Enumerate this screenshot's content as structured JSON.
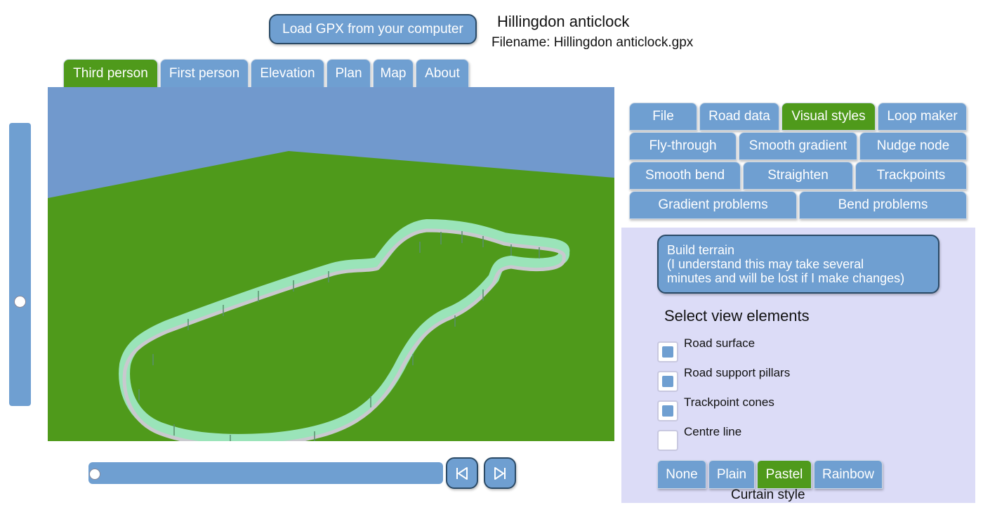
{
  "header": {
    "load_button": "Load GPX from your computer",
    "route_title": "Hillingdon anticlock",
    "filename": "Filename: Hillingdon anticlock.gpx"
  },
  "view_tabs": [
    {
      "label": "Third person",
      "active": true
    },
    {
      "label": "First person",
      "active": false
    },
    {
      "label": "Elevation",
      "active": false
    },
    {
      "label": "Plan",
      "active": false
    },
    {
      "label": "Map",
      "active": false
    },
    {
      "label": "About",
      "active": false
    }
  ],
  "viewport": {
    "sky_color": "#7199cd",
    "ground_color": "#4f9a1b",
    "track_color": "#9ee8c2",
    "track_edge_color": "#c9c9cf"
  },
  "playback": {
    "position": 0.0,
    "zoom": 0.36,
    "prev_icon": "skip-to-start-icon",
    "next_icon": "skip-to-end-icon"
  },
  "tool_tabs": {
    "row1": [
      {
        "label": "File",
        "active": false
      },
      {
        "label": "Road data",
        "active": false
      },
      {
        "label": "Visual styles",
        "active": true
      },
      {
        "label": "Loop maker",
        "active": false
      }
    ],
    "row2": [
      {
        "label": "Fly-through"
      },
      {
        "label": "Smooth gradient"
      },
      {
        "label": "Nudge node"
      }
    ],
    "row3": [
      {
        "label": "Smooth bend"
      },
      {
        "label": "Straighten"
      },
      {
        "label": "Trackpoints"
      }
    ],
    "row4": [
      {
        "label": "Gradient problems"
      },
      {
        "label": "Bend problems"
      }
    ]
  },
  "visual_styles": {
    "build_terrain_lines": [
      "Build terrain",
      "(I understand this may take several",
      "minutes and will be lost if I make changes)"
    ],
    "heading": "Select view elements",
    "elements": [
      {
        "label": "Road surface",
        "checked": true
      },
      {
        "label": "Road support pillars",
        "checked": true
      },
      {
        "label": "Trackpoint cones",
        "checked": true
      },
      {
        "label": "Centre line",
        "checked": false
      }
    ],
    "curtain_options": [
      {
        "label": "None",
        "active": false
      },
      {
        "label": "Plain",
        "active": false
      },
      {
        "label": "Pastel",
        "active": true
      },
      {
        "label": "Rainbow",
        "active": false
      }
    ],
    "curtain_label": "Curtain style"
  },
  "colors": {
    "button": "#6f9fd1",
    "active": "#4f9a1b",
    "panel": "#dcdcf7"
  }
}
